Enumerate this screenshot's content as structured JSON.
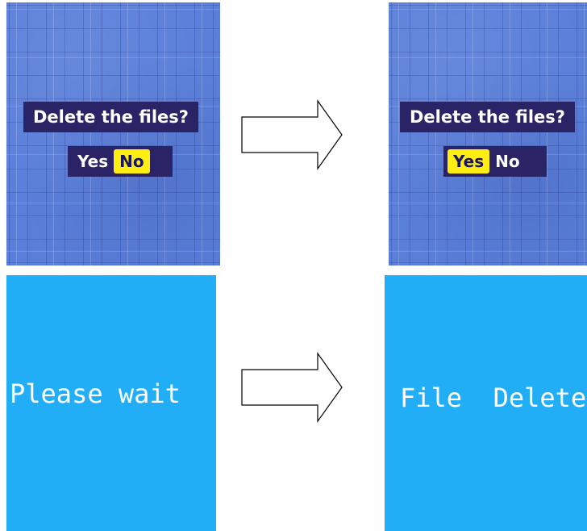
{
  "steps": [
    {
      "dialog": {
        "prompt": "Delete the files?",
        "yes_label": "Yes",
        "no_label": "No",
        "selected": "No"
      }
    },
    {
      "dialog": {
        "prompt": "Delete the files?",
        "yes_label": "Yes",
        "no_label": "No",
        "selected": "Yes"
      }
    },
    {
      "status": "Please wait"
    },
    {
      "status": "File  Deleted!"
    }
  ],
  "colors": {
    "tile_background": "#5a7fd9",
    "dialog_background": "#2a2365",
    "selection": "#ffee11",
    "status_background": "#22aef6",
    "text": "#ffffff"
  },
  "icons": [
    "right-arrow-icon",
    "right-arrow-icon"
  ]
}
